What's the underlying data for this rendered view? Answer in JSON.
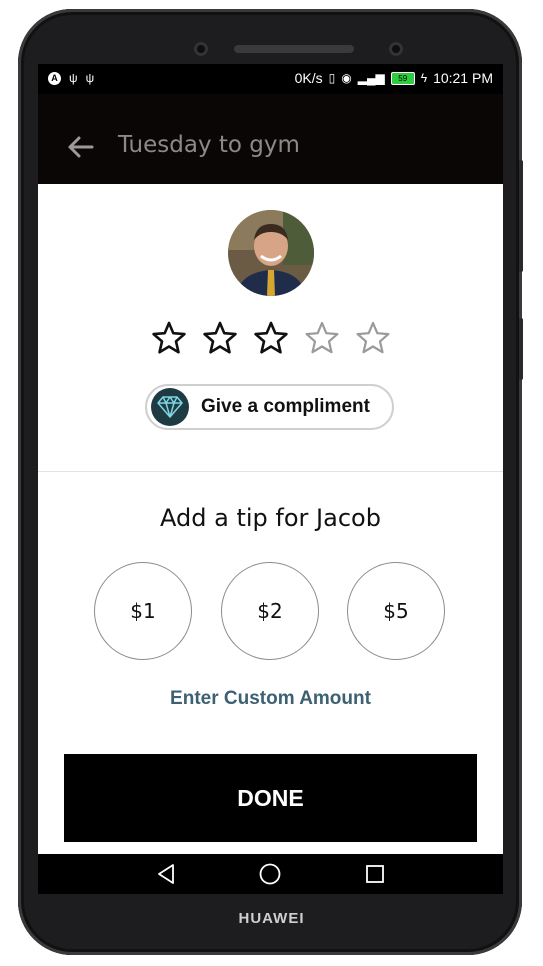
{
  "device": {
    "brand": "HUAWEI"
  },
  "status_bar": {
    "speed": "0K/s",
    "battery_level": "59",
    "time": "10:21 PM",
    "left_icons": [
      "a-icon",
      "usb-icon",
      "usb-icon"
    ],
    "right_icons": [
      "vibrate-icon",
      "eye-icon",
      "signal-icon",
      "battery-icon",
      "charging-icon"
    ]
  },
  "app_bar": {
    "title": "Tuesday to gym",
    "back_icon": "arrow-left-icon"
  },
  "rating": {
    "value": 3,
    "max": 5
  },
  "compliment": {
    "label": "Give a compliment",
    "icon": "diamond-icon"
  },
  "tip": {
    "title": "Add a tip for Jacob",
    "options": [
      "$1",
      "$2",
      "$5"
    ],
    "custom_label": "Enter Custom Amount"
  },
  "done_label": "DONE",
  "nav": {
    "icons": [
      "back-triangle-icon",
      "home-circle-icon",
      "recents-square-icon"
    ]
  },
  "colors": {
    "app_bar": "#0a0606",
    "accent": "#3d6073",
    "diamond_bg": "#1e3b44"
  }
}
